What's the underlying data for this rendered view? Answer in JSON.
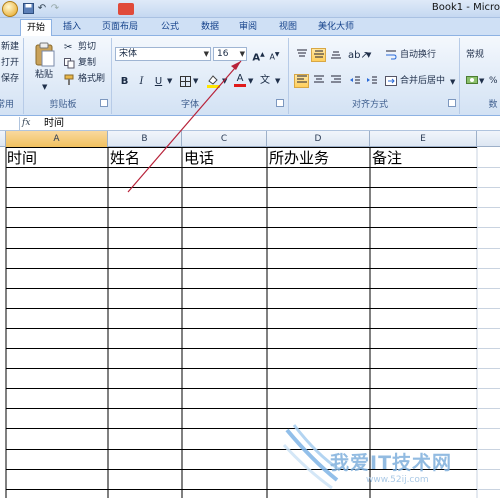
{
  "titlebar": {
    "window_title": "Book1 - Micro",
    "qat_icons": [
      "save-icon",
      "undo-icon",
      "redo-icon"
    ]
  },
  "tabs": [
    "开始",
    "插入",
    "页面布局",
    "公式",
    "数据",
    "审阅",
    "视图",
    "美化大师"
  ],
  "ribbon": {
    "side_buttons": [
      "新建",
      "打开",
      "保存"
    ],
    "side_group_label": "常用",
    "clipboard": {
      "paste": "粘贴",
      "cut": "剪切",
      "copy": "复制",
      "format_painter": "格式刷",
      "label": "剪贴板"
    },
    "font": {
      "font_name": "宋体",
      "font_size": "16",
      "bold": "B",
      "italic": "I",
      "underline": "U",
      "grow": "A",
      "shrink": "A",
      "font_color_letter": "A",
      "label": "字体"
    },
    "alignment": {
      "wrap_text": "自动换行",
      "merge_center": "合并后居中",
      "label": "对齐方式"
    },
    "number": {
      "format": "常规",
      "percent": "%",
      "label": "数"
    }
  },
  "formula_bar": {
    "fx": "fx",
    "content": "时间"
  },
  "grid": {
    "columns": [
      "A",
      "B",
      "C",
      "D",
      "E"
    ],
    "headers": [
      "时间",
      "姓名",
      "电话",
      "所办业务",
      "备注"
    ],
    "empty_rows": 17
  },
  "watermark": {
    "text": "我爱IT技术网",
    "url": "www.52ij.com"
  },
  "colors": {
    "accent": "#8db2e3",
    "arrow": "#b8233a",
    "grid_line": "#000000"
  }
}
